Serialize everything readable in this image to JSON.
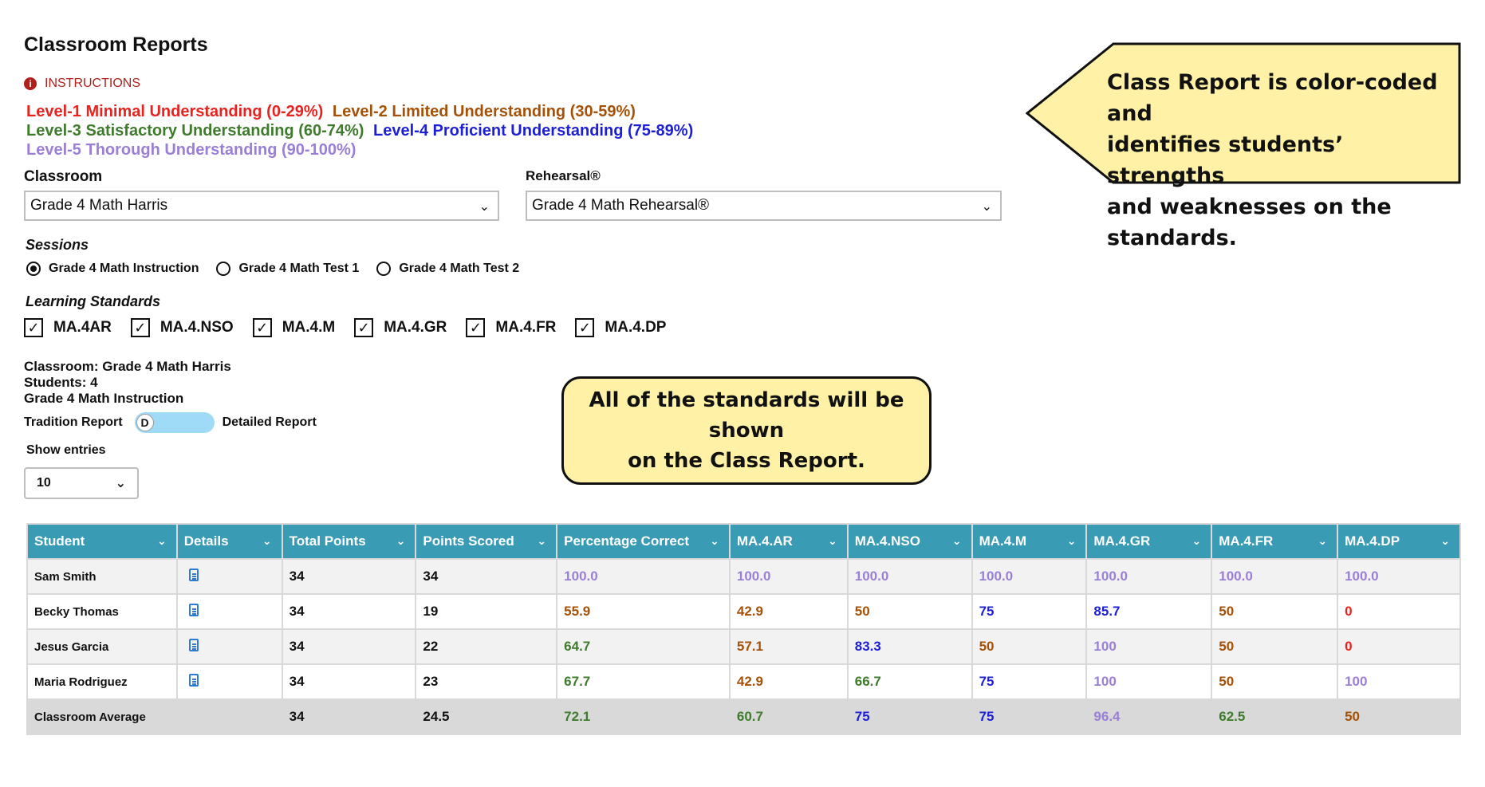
{
  "page_title": "Classroom Reports",
  "instructions_label": "INSTRUCTIONS",
  "levels": [
    {
      "text": "Level-1 Minimal Understanding (0-29%)",
      "color": "#e8231f"
    },
    {
      "text": "Level-2 Limited Understanding (30-59%)",
      "color": "#a55208"
    },
    {
      "text": "Level-3 Satisfactory Understanding (60-74%)",
      "color": "#3f7b2d"
    },
    {
      "text": "Level-4 Proficient Understanding (75-89%)",
      "color": "#1d1fd6"
    },
    {
      "text": "Level-5 Thorough Understanding (90-100%)",
      "color": "#9b7fd6"
    }
  ],
  "classroom": {
    "label": "Classroom",
    "value": "Grade 4 Math Harris"
  },
  "rehearsal": {
    "label": "Rehearsal®",
    "value": "Grade 4 Math Rehearsal®"
  },
  "sessions": {
    "label": "Sessions",
    "options": [
      "Grade 4 Math Instruction",
      "Grade 4 Math Test 1",
      "Grade 4 Math Test 2"
    ],
    "selected": 0
  },
  "standards": {
    "label": "Learning Standards",
    "items": [
      "MA.4AR",
      "MA.4.NSO",
      "MA.4.M",
      "MA.4.GR",
      "MA.4.FR",
      "MA.4.DP"
    ]
  },
  "summary": {
    "classroom_line": "Classroom: Grade 4 Math Harris",
    "students_line": "Students: 4",
    "session_line": "Grade 4 Math Instruction"
  },
  "toggle": {
    "left_label": "Tradition Report",
    "knob_letter": "D",
    "right_label": "Detailed Report"
  },
  "entries": {
    "label": "Show entries",
    "value": "10"
  },
  "callouts": {
    "top": [
      "Class Report is color-coded and",
      "identifies students’ strengths",
      "and weaknesses on the standards."
    ],
    "middle": [
      "All of the standards will be shown",
      "on the Class Report."
    ]
  },
  "table": {
    "headers": [
      "Student",
      "Details",
      "Total Points",
      "Points Scored",
      "Percentage Correct",
      "MA.4.AR",
      "MA.4.NSO",
      "MA.4.M",
      "MA.4.GR",
      "MA.4.FR",
      "MA.4.DP"
    ],
    "rows": [
      {
        "name": "Sam Smith",
        "total": "34",
        "scored": "34",
        "values": [
          [
            "100.0",
            "#9b7fd6"
          ],
          [
            "100.0",
            "#9b7fd6"
          ],
          [
            "100.0",
            "#9b7fd6"
          ],
          [
            "100.0",
            "#9b7fd6"
          ],
          [
            "100.0",
            "#9b7fd6"
          ],
          [
            "100.0",
            "#9b7fd6"
          ],
          [
            "100.0",
            "#9b7fd6"
          ]
        ]
      },
      {
        "name": "Becky Thomas",
        "total": "34",
        "scored": "19",
        "values": [
          [
            "55.9",
            "#a55208"
          ],
          [
            "42.9",
            "#a55208"
          ],
          [
            "50",
            "#a55208"
          ],
          [
            "75",
            "#1d1fd6"
          ],
          [
            "85.7",
            "#1d1fd6"
          ],
          [
            "50",
            "#a55208"
          ],
          [
            "0",
            "#e8231f"
          ]
        ]
      },
      {
        "name": "Jesus Garcia",
        "total": "34",
        "scored": "22",
        "values": [
          [
            "64.7",
            "#3f7b2d"
          ],
          [
            "57.1",
            "#a55208"
          ],
          [
            "83.3",
            "#1d1fd6"
          ],
          [
            "50",
            "#a55208"
          ],
          [
            "100",
            "#9b7fd6"
          ],
          [
            "50",
            "#a55208"
          ],
          [
            "0",
            "#e8231f"
          ]
        ]
      },
      {
        "name": "Maria Rodriguez",
        "total": "34",
        "scored": "23",
        "values": [
          [
            "67.7",
            "#3f7b2d"
          ],
          [
            "42.9",
            "#a55208"
          ],
          [
            "66.7",
            "#3f7b2d"
          ],
          [
            "75",
            "#1d1fd6"
          ],
          [
            "100",
            "#9b7fd6"
          ],
          [
            "50",
            "#a55208"
          ],
          [
            "100",
            "#9b7fd6"
          ]
        ]
      }
    ],
    "average": {
      "name": "Classroom Average",
      "total": "34",
      "scored": "24.5",
      "values": [
        [
          "72.1",
          "#3f7b2d"
        ],
        [
          "60.7",
          "#3f7b2d"
        ],
        [
          "75",
          "#1d1fd6"
        ],
        [
          "75",
          "#1d1fd6"
        ],
        [
          "96.4",
          "#9b7fd6"
        ],
        [
          "62.5",
          "#3f7b2d"
        ],
        [
          "50",
          "#a55208"
        ]
      ]
    }
  }
}
